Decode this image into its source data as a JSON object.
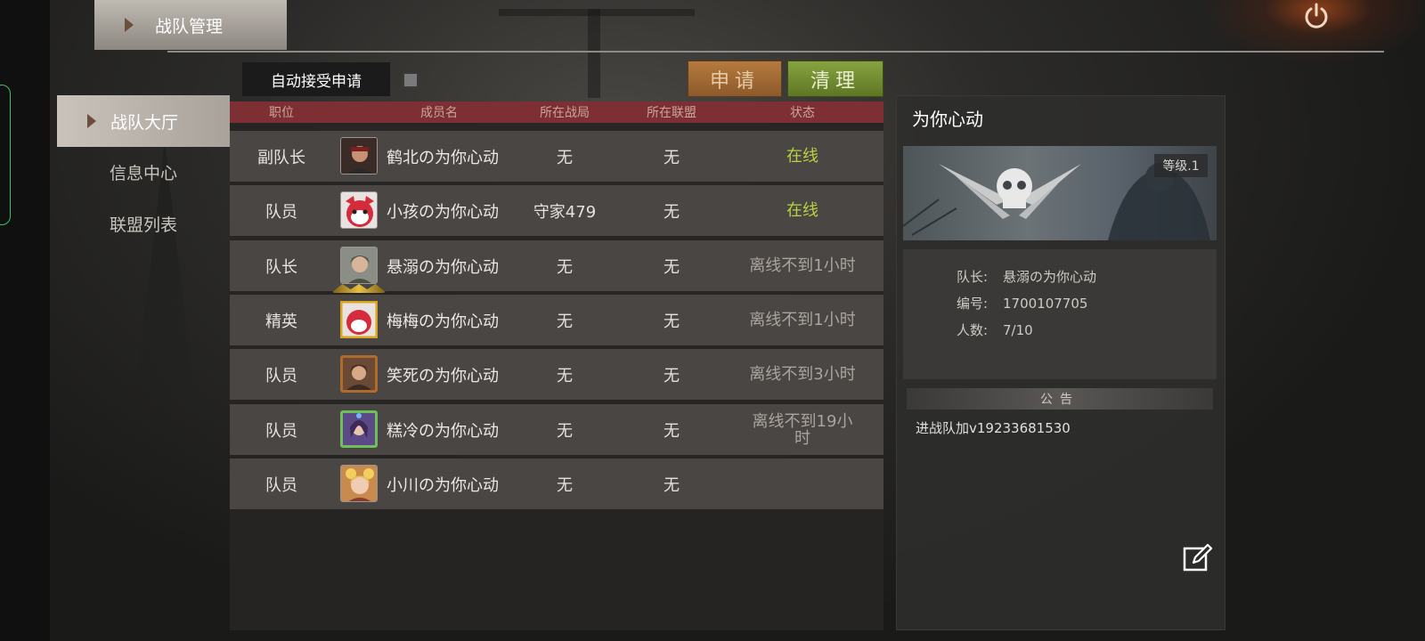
{
  "title_tab": {
    "label": "战队管理"
  },
  "sidebar": {
    "items": [
      {
        "label": "战队大厅",
        "active": true
      },
      {
        "label": "信息中心",
        "active": false
      },
      {
        "label": "联盟列表",
        "active": false
      }
    ]
  },
  "toolbar": {
    "auto_accept_label": "自动接受申请",
    "auto_accept_checked": false,
    "apply_label": "申请",
    "clear_label": "清理"
  },
  "table": {
    "columns": [
      "职位",
      "成员名",
      "所在战局",
      "所在联盟",
      "状态"
    ],
    "rows": [
      {
        "role": "副队长",
        "name": "鹤北の为你心动",
        "battle": "无",
        "alliance": "无",
        "status": "在线",
        "avatar": "avatar-headband-man"
      },
      {
        "role": "队员",
        "name": "小孩の为你心动",
        "battle": "守家479",
        "alliance": "无",
        "status": "在线",
        "avatar": "avatar-red-fox"
      },
      {
        "role": "队长",
        "name": "悬溺の为你心动",
        "battle": "无",
        "alliance": "无",
        "status": "离线不到1小时",
        "avatar": "avatar-soldier-woman"
      },
      {
        "role": "精英",
        "name": "梅梅の为你心动",
        "battle": "无",
        "alliance": "无",
        "status": "离线不到1小时",
        "avatar": "avatar-red-fox-gold-frame"
      },
      {
        "role": "队员",
        "name": "笑死の为你心动",
        "battle": "无",
        "alliance": "无",
        "status": "离线不到3小时",
        "avatar": "avatar-woman-bronze-frame"
      },
      {
        "role": "队员",
        "name": "糕冷の为你心动",
        "battle": "无",
        "alliance": "无",
        "status": "离线不到19小时",
        "avatar": "avatar-girl-jeweled-frame"
      },
      {
        "role": "队员",
        "name": "小川の为你心动",
        "battle": "无",
        "alliance": "无",
        "status": "",
        "avatar": "avatar-blonde-girl"
      }
    ]
  },
  "team_info": {
    "name": "为你心动",
    "level": "等级.1",
    "leader_label": "队长:",
    "leader": "悬溺の为你心动",
    "id_label": "编号:",
    "id": "1700107705",
    "count_label": "人数:",
    "count": "7/10",
    "notice_title": "公告",
    "notice_text": "进战队加v19233681530"
  },
  "colors": {
    "online": "#b8d23f",
    "offline": "#aaa49e",
    "header": "#7d2f33",
    "apply": "#b57a3e",
    "clear": "#87a33f"
  }
}
